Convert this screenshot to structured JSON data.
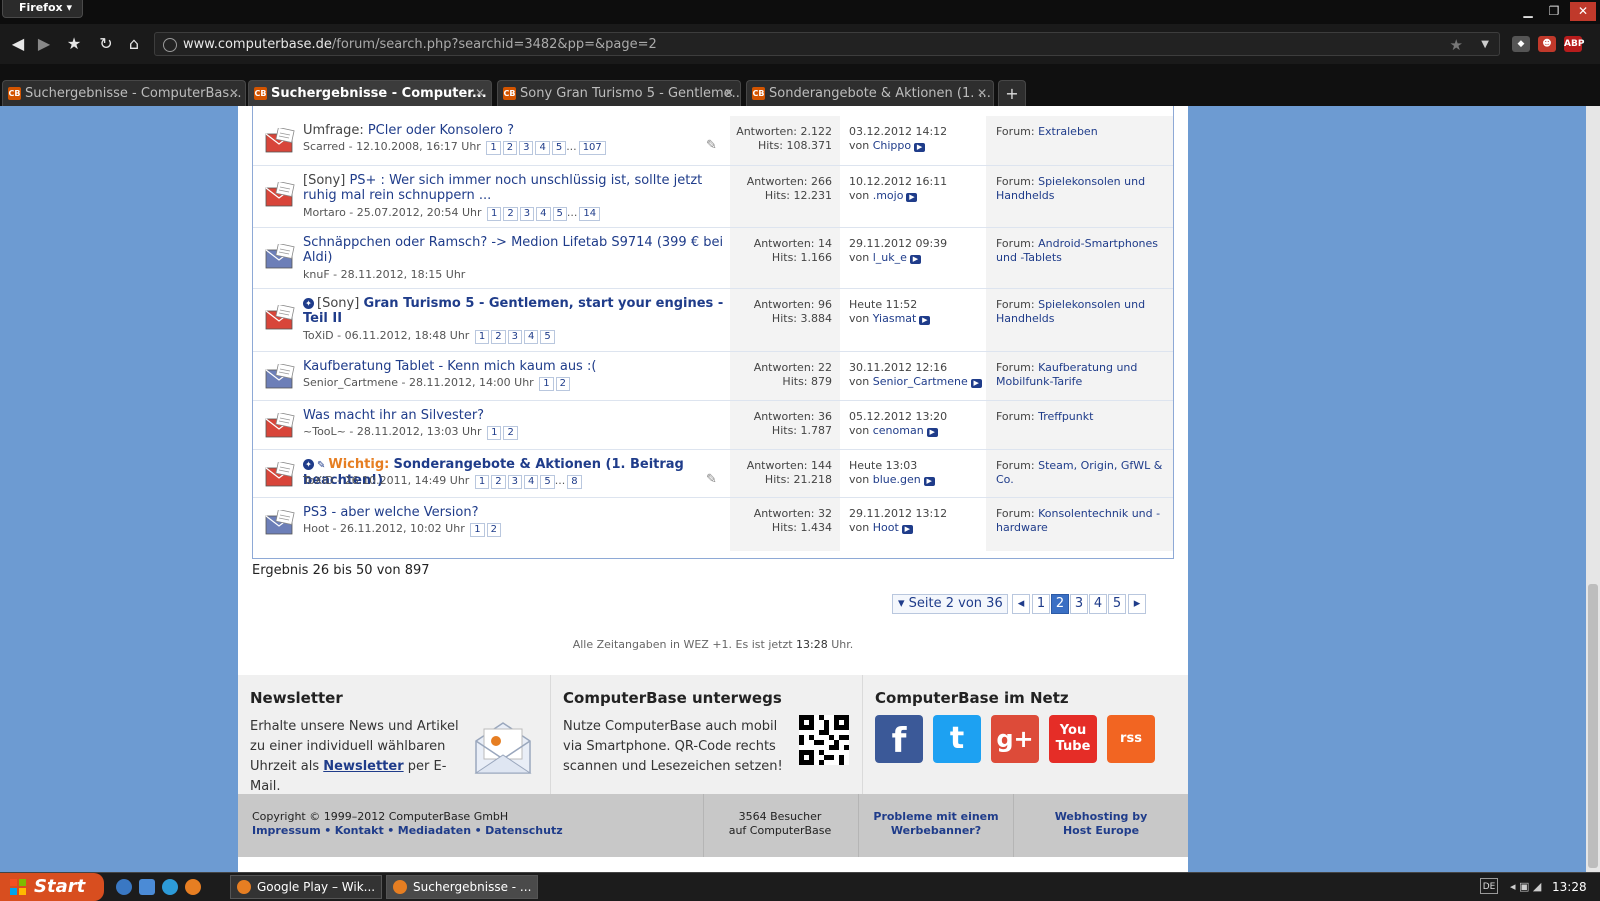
{
  "browser": {
    "menu_label": "Firefox ▾",
    "url_host": "www.computerbase.de",
    "url_path": "/forum/search.php?searchid=3482&pp=&page=2",
    "tabs": [
      {
        "label": "Suchergebnisse - ComputerBas..."
      },
      {
        "label": "Suchergebnisse - Computer..."
      },
      {
        "label": "Sony Gran Turismo 5 - Gentleme..."
      },
      {
        "label": "Sonderangebote & Aktionen (1. ..."
      }
    ],
    "new_tab_label": "+",
    "tab_favicon_text": "CB"
  },
  "results": {
    "rows": [
      {
        "prefix": "Umfrage:",
        "title": "PCler oder Konsolero ?",
        "meta": "Scarred - 12.10.2008, 16:17 Uhr",
        "pages": [
          "1",
          "2",
          "3",
          "4",
          "5",
          "...",
          "107"
        ],
        "replies": "Antworten: 2.122",
        "hits": "Hits: 108.371",
        "last_date": "03.12.2012 14:12",
        "last_by": "von",
        "last_user": "Chippo",
        "forum_label": "Forum:",
        "forum": "Extraleben"
      },
      {
        "prefix": "[Sony]",
        "title": "PS+ : Wer sich immer noch unschlüssig ist, sollte jetzt ruhig mal rein schnuppern ...",
        "meta": "Mortaro - 25.07.2012, 20:54 Uhr",
        "pages": [
          "1",
          "2",
          "3",
          "4",
          "5",
          "...",
          "14"
        ],
        "replies": "Antworten: 266",
        "hits": "Hits: 12.231",
        "last_date": "10.12.2012 16:11",
        "last_by": "von",
        "last_user": ".mojo",
        "forum_label": "Forum:",
        "forum": "Spielekonsolen und Handhelds"
      },
      {
        "prefix": "",
        "title": "Schnäppchen oder Ramsch? -> Medion Lifetab S9714 (399 € bei Aldi)",
        "meta": "knuF - 28.11.2012, 18:15 Uhr",
        "pages": [],
        "replies": "Antworten: 14",
        "hits": "Hits: 1.166",
        "last_date": "29.11.2012 09:39",
        "last_by": "von",
        "last_user": "l_uk_e",
        "forum_label": "Forum:",
        "forum": "Android-Smartphones und -Tablets"
      },
      {
        "prefix": "[Sony]",
        "title": "Gran Turismo 5 - Gentlemen, start your engines - Teil II",
        "meta": "ToXiD - 06.11.2012, 18:48 Uhr",
        "pages": [
          "1",
          "2",
          "3",
          "4",
          "5"
        ],
        "replies": "Antworten: 96",
        "hits": "Hits: 3.884",
        "last_date": "Heute 11:52",
        "last_by": "von",
        "last_user": "Yiasmat",
        "forum_label": "Forum:",
        "forum": "Spielekonsolen und Handhelds"
      },
      {
        "prefix": "",
        "title": "Kaufberatung Tablet - Kenn mich kaum aus :(",
        "meta": "Senior_Cartmene - 28.11.2012, 14:00 Uhr",
        "pages": [
          "1",
          "2"
        ],
        "replies": "Antworten: 22",
        "hits": "Hits: 879",
        "last_date": "30.11.2012 12:16",
        "last_by": "von",
        "last_user": "Senior_Cartmene",
        "forum_label": "Forum:",
        "forum": "Kaufberatung und Mobilfunk-Tarife"
      },
      {
        "prefix": "",
        "title": "Was macht ihr an Silvester?",
        "meta": "~TooL~ - 28.11.2012, 13:03 Uhr",
        "pages": [
          "1",
          "2"
        ],
        "replies": "Antworten: 36",
        "hits": "Hits: 1.787",
        "last_date": "05.12.2012 13:20",
        "last_by": "von",
        "last_user": "cenoman",
        "forum_label": "Forum:",
        "forum": "Treffpunkt"
      },
      {
        "prefix": "Wichtig:",
        "title": "Sonderangebote & Aktionen (1. Beitrag beachten!)",
        "meta": "ToXiD - 26.10.2011, 14:49 Uhr",
        "pages": [
          "1",
          "2",
          "3",
          "4",
          "5",
          "...",
          "8"
        ],
        "replies": "Antworten: 144",
        "hits": "Hits: 21.218",
        "last_date": "Heute 13:03",
        "last_by": "von",
        "last_user": "blue.gen",
        "forum_label": "Forum:",
        "forum": "Steam, Origin, GfWL & Co."
      },
      {
        "prefix": "",
        "title": "PS3 - aber welche Version?",
        "meta": "Hoot - 26.11.2012, 10:02 Uhr",
        "pages": [
          "1",
          "2"
        ],
        "replies": "Antworten: 32",
        "hits": "Hits: 1.434",
        "last_date": "29.11.2012 13:12",
        "last_by": "von",
        "last_user": "Hoot",
        "forum_label": "Forum:",
        "forum": "Konsolentechnik und -hardware"
      }
    ],
    "count_text": "Ergebnis 26 bis 50 von 897"
  },
  "pager": {
    "label": "▾ Seite 2 von 36",
    "prev": "◂",
    "next": "▸",
    "pages": [
      "1",
      "2",
      "3",
      "4",
      "5"
    ],
    "current": "2"
  },
  "timezone": {
    "text": "Alle Zeitangaben in WEZ +1. Es ist jetzt ",
    "time": "13:28",
    "suffix": " Uhr."
  },
  "footer": {
    "newsletter": {
      "title": "Newsletter",
      "text": "Erhalte unsere News und Artikel zu einer individuell wählbaren Uhrzeit als ",
      "link": "Newsletter",
      "suffix": " per E-Mail."
    },
    "mobile": {
      "title": "ComputerBase unterwegs",
      "text": "Nutze ComputerBase auch mobil via Smartphone. QR-Code rechts scannen und Lesezeichen setzen!"
    },
    "social": {
      "title": "ComputerBase im Netz",
      "items": [
        {
          "name": "facebook",
          "glyph": "f",
          "color": "#3b5998"
        },
        {
          "name": "twitter",
          "glyph": "t",
          "color": "#1da1f2"
        },
        {
          "name": "google-plus",
          "glyph": "g+",
          "color": "#dd4b39"
        },
        {
          "name": "youtube",
          "glyph": "You Tube",
          "color": "#e52d27"
        },
        {
          "name": "rss",
          "glyph": "rss",
          "color": "#f26522"
        }
      ]
    },
    "copyright": "Copyright © 1999–2012 ComputerBase GmbH",
    "links": [
      "Impressum",
      "Kontakt",
      "Mediadaten",
      "Datenschutz"
    ],
    "visitors_line1": "3564 Besucher",
    "visitors_line2": "auf ComputerBase",
    "banner_line1": "Probleme mit einem",
    "banner_line2": "Werbebanner?",
    "hosting_line1": "Webhosting by",
    "hosting_line2": "Host Europe"
  },
  "taskbar": {
    "start_label": "Start",
    "items": [
      {
        "label": "Google Play – Wik..."
      },
      {
        "label": "Suchergebnisse - ..."
      }
    ],
    "lang": "DE",
    "clock": "13:28"
  }
}
